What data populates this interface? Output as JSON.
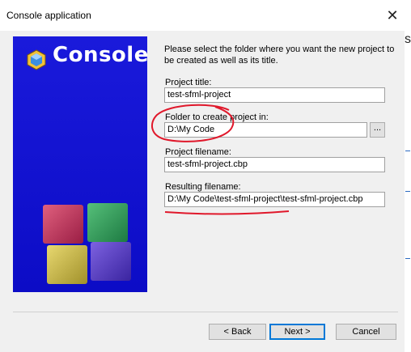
{
  "window": {
    "title": "Console application",
    "close_glyph": "✕"
  },
  "banner": {
    "title": "Console",
    "logo_icon": "codeblocks-logo",
    "cube_colors": [
      "#c0305a",
      "#2f9d5a",
      "#c8b84a",
      "#5b3fc6"
    ],
    "background": "#1313d4"
  },
  "form": {
    "intro": "Please select the folder where you want the new project to be created as well as its title.",
    "project_title_label": "Project title:",
    "project_title_value": "test-sfml-project",
    "folder_label": "Folder to create project in:",
    "folder_value": "D:\\My Code",
    "browse_label": "...",
    "filename_label": "Project filename:",
    "filename_value": "test-sfml-project.cbp",
    "resulting_label": "Resulting filename:",
    "resulting_value": "D:\\My Code\\test-sfml-project\\test-sfml-project.cbp"
  },
  "buttons": {
    "back": "< Back",
    "next": "Next >",
    "cancel": "Cancel"
  },
  "background_fragment": {
    "glyph": "s"
  },
  "colors": {
    "annotation": "#e0182b",
    "banner_text": "#ffffff",
    "default_button_border": "#0078d7"
  }
}
